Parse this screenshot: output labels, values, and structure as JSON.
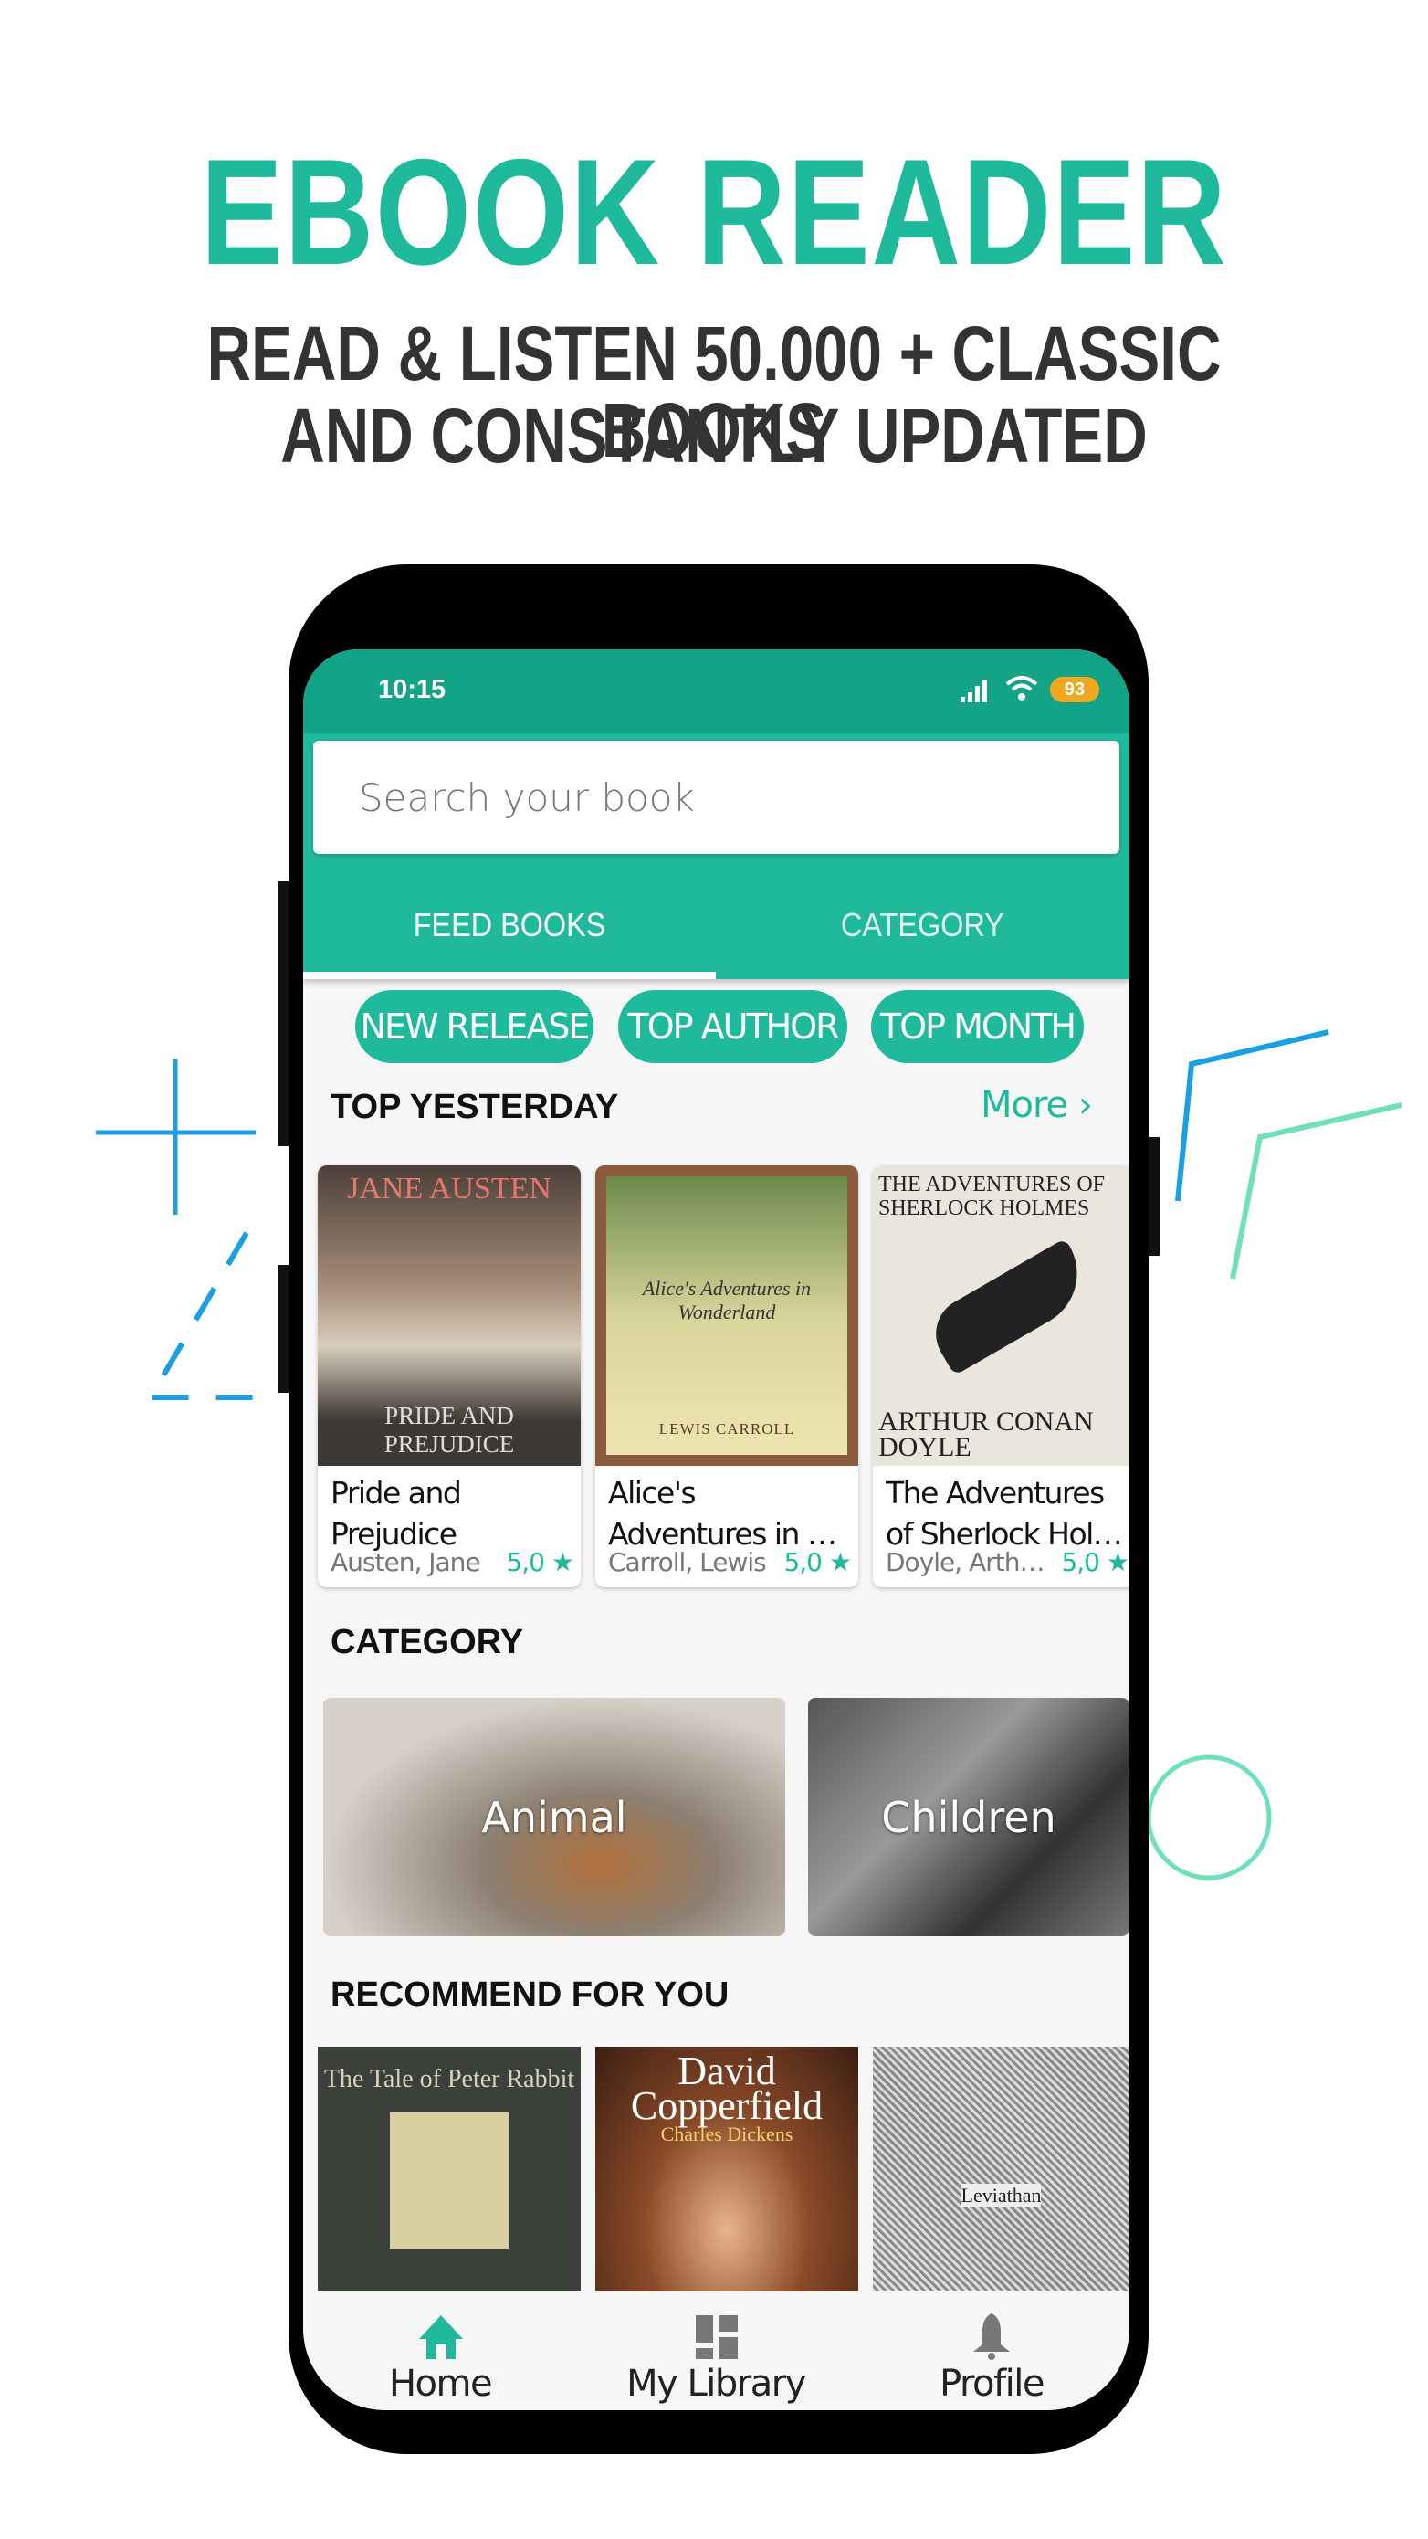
{
  "promo": {
    "headline": "EBOOK READER",
    "subtitle_line1": "READ & LISTEN 50.000 + CLASSIC BOOKS",
    "subtitle_line2": "AND CONSTANTLY UPDATED"
  },
  "colors": {
    "accent": "#1fba9b",
    "status_bar": "#13a386",
    "headline": "#1fba9b",
    "battery": "#f0a81e"
  },
  "status_bar": {
    "time": "10:15",
    "battery": "93",
    "icons": [
      "signal-icon",
      "wifi-icon",
      "battery-icon"
    ]
  },
  "search": {
    "placeholder": "Search your book",
    "value": ""
  },
  "tabs": [
    {
      "label": "FEED BOOKS",
      "active": true
    },
    {
      "label": "CATEGORY",
      "active": false
    }
  ],
  "chips": [
    "NEW RELEASE",
    "TOP AUTHOR",
    "TOP MONTH"
  ],
  "top_yesterday": {
    "heading": "TOP YESTERDAY",
    "more": "More",
    "books": [
      {
        "title": "Pride and Prejudice",
        "author": "Austen, Jane",
        "rating": "5,0 ★",
        "cover_text": "JANE AUSTEN",
        "cover_sub": "PRIDE AND PREJUDICE"
      },
      {
        "title": "Alice's Adventures in …",
        "author": "Carroll, Lewis",
        "rating": "5,0 ★",
        "cover_text": "Alice's Adventures in Wonderland",
        "cover_sub": "LEWIS CARROLL"
      },
      {
        "title": "The Adventures of Sherlock Hol…",
        "author": "Doyle, Arth…",
        "rating": "5,0 ★",
        "cover_text": "THE ADVENTURES OF SHERLOCK HOLMES",
        "cover_sub": "ARTHUR CONAN DOYLE"
      }
    ]
  },
  "category": {
    "heading": "CATEGORY",
    "items": [
      "Animal",
      "Children"
    ]
  },
  "recommend": {
    "heading": "RECOMMEND FOR YOU",
    "covers": [
      "The Tale of Peter Rabbit",
      "David Copperfield",
      "Leviathan"
    ],
    "cover_sub": "Charles Dickens"
  },
  "bottom_nav": [
    {
      "label": "Home",
      "icon": "home-icon",
      "active": true
    },
    {
      "label": "My Library",
      "icon": "library-icon",
      "active": false
    },
    {
      "label": "Profile",
      "icon": "bell-icon",
      "active": false
    }
  ]
}
